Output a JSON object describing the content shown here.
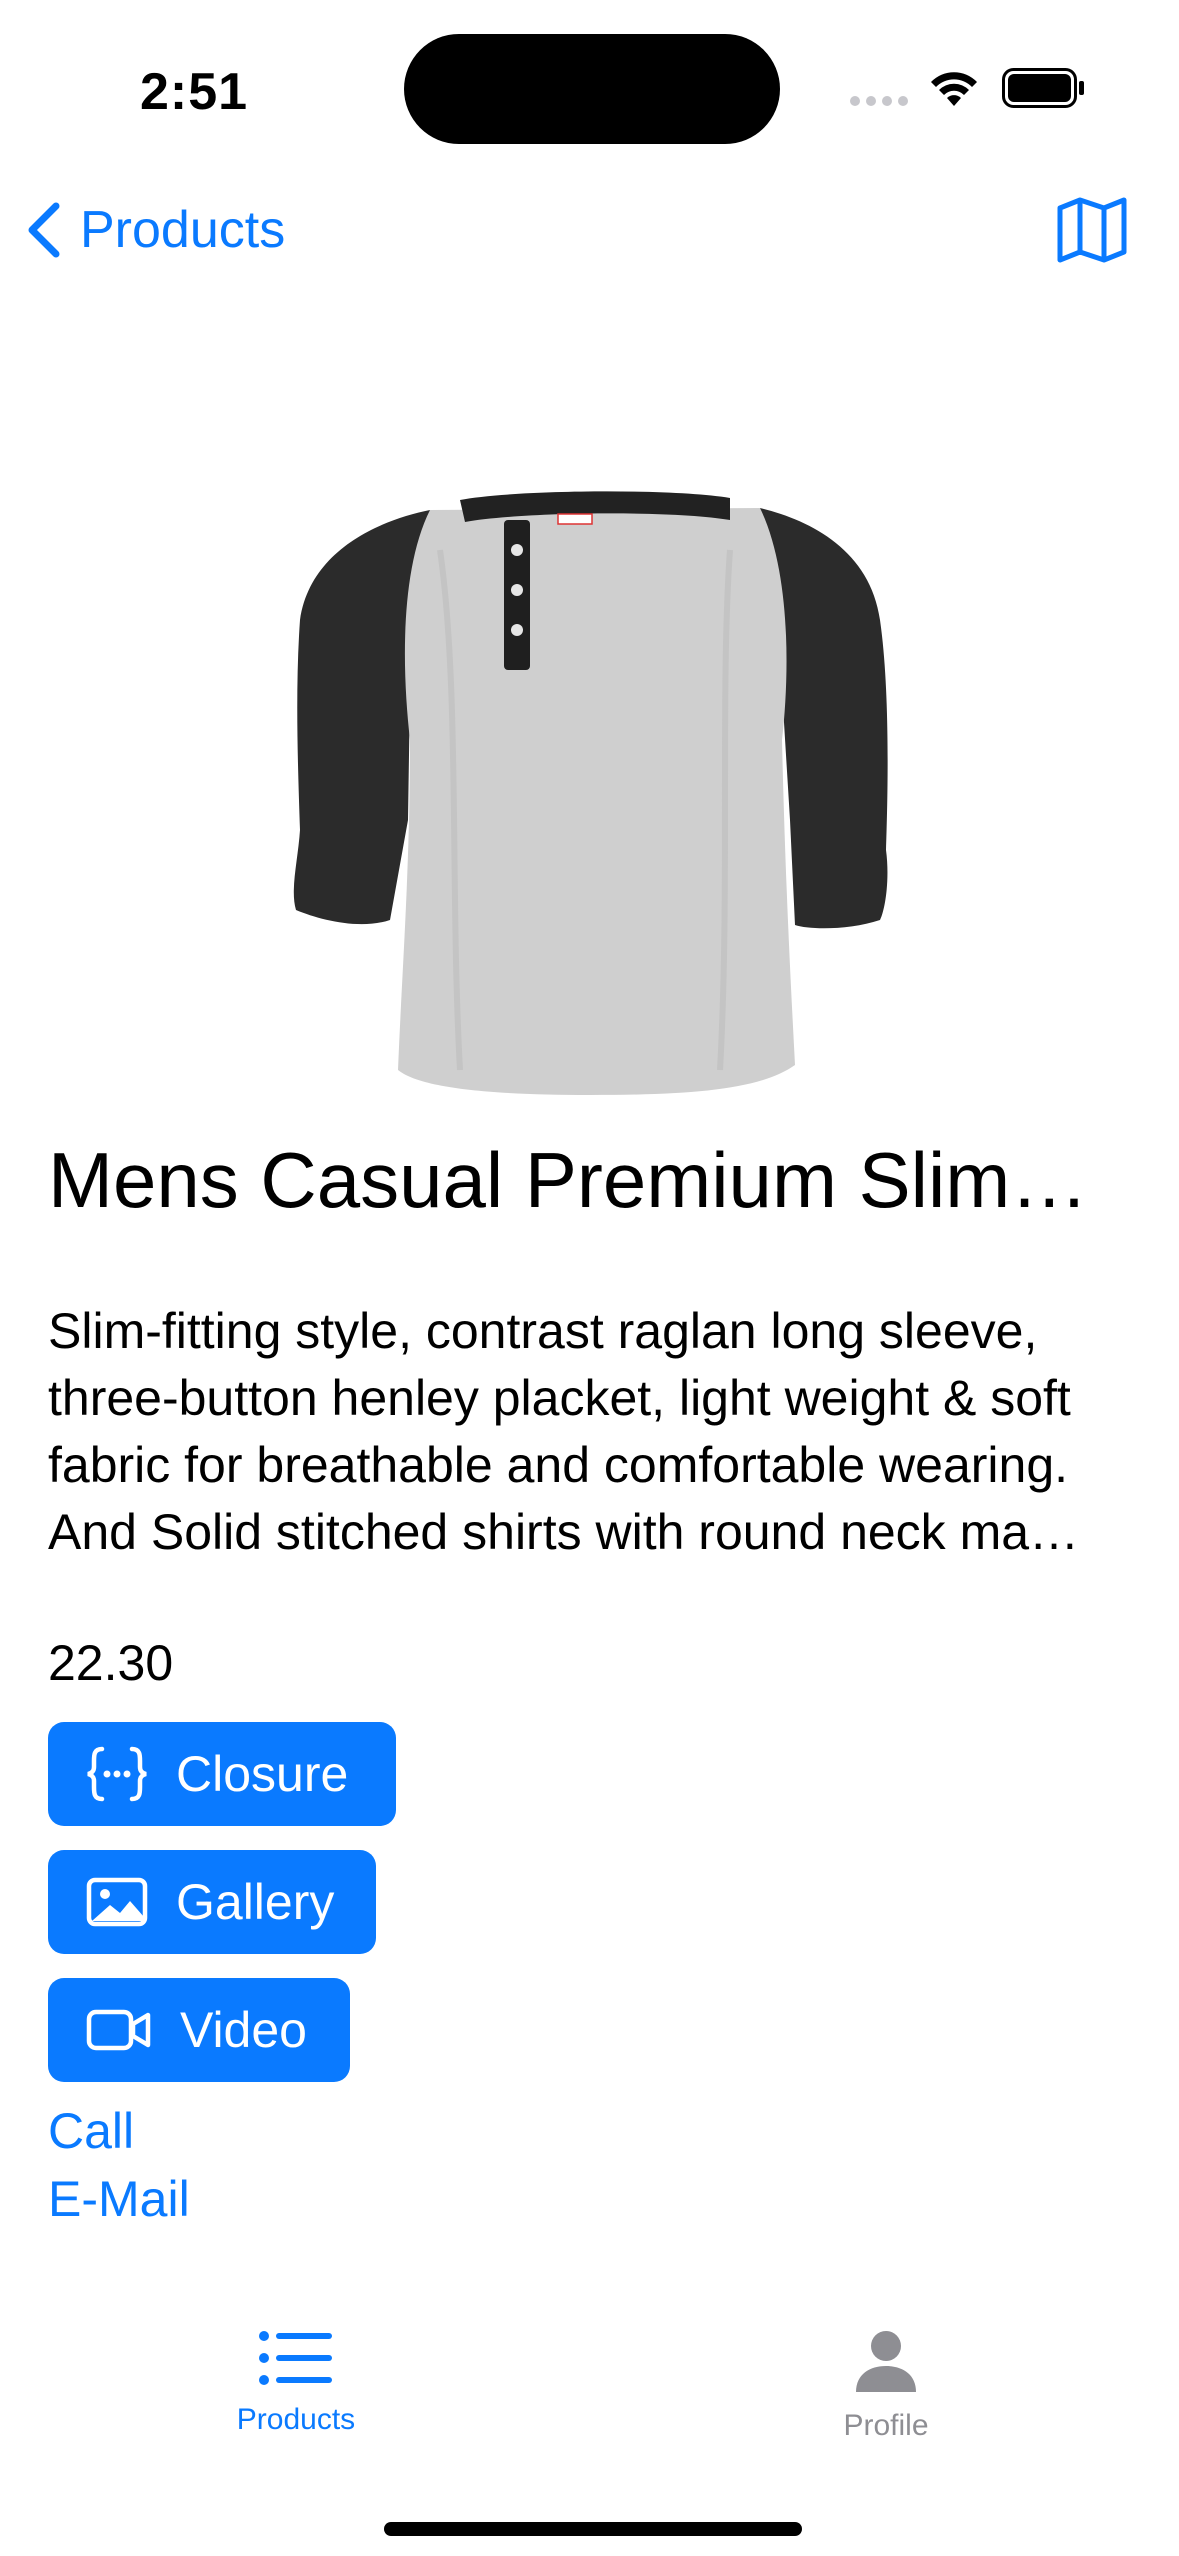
{
  "status_bar": {
    "time": "2:51",
    "icons": [
      "cellular-dots-icon",
      "wifi-icon",
      "battery-icon"
    ]
  },
  "nav": {
    "back_label": "Products",
    "back_icon": "chevron-left-icon",
    "right_icon": "map-icon"
  },
  "product": {
    "image_icon": "raglan-henley-shirt-image",
    "title": "Mens Casual Premium Slim…",
    "description": "Slim-fitting style, contrast raglan long sleeve, three-button henley placket, light weight & soft fabric for breathable and comfortable wearing. And Solid stitched shirts with round neck ma…",
    "price": "22.30"
  },
  "actions": [
    {
      "label": "Closure",
      "icon": "curly-braces-icon"
    },
    {
      "label": "Gallery",
      "icon": "photo-icon"
    },
    {
      "label": "Video",
      "icon": "video-camera-icon"
    }
  ],
  "links": {
    "call": "Call",
    "email": "E-Mail"
  },
  "tab_bar": {
    "tabs": [
      {
        "label": "Products",
        "icon": "list-bullet-icon",
        "selected": true
      },
      {
        "label": "Profile",
        "icon": "person-icon",
        "selected": false
      }
    ]
  },
  "colors": {
    "accent": "#0a7aff",
    "inactive_tab": "#8e8e93",
    "text": "#000000",
    "background": "#ffffff"
  }
}
